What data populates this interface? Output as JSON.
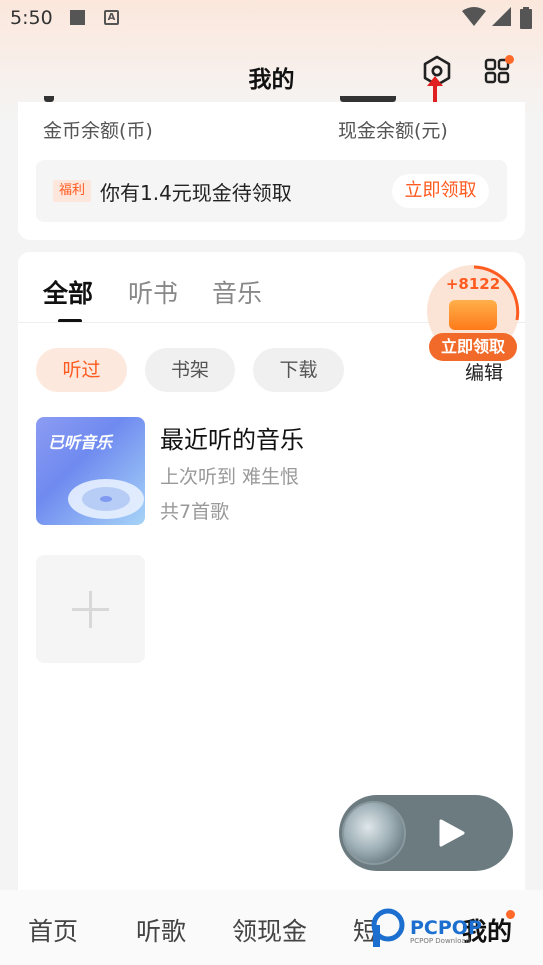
{
  "status_bar": {
    "time": "5:50"
  },
  "header": {
    "title": "我的"
  },
  "balance": {
    "coin_label": "金币余额(币)",
    "cash_label": "现金余额(元)",
    "welfare_tag": "福利",
    "welfare_text": "你有1.4元现金待领取",
    "claim_label": "立即领取"
  },
  "tabs": [
    {
      "label": "全部",
      "active": true
    },
    {
      "label": "听书",
      "active": false
    },
    {
      "label": "音乐",
      "active": false
    }
  ],
  "filters": [
    {
      "label": "听过",
      "active": true
    },
    {
      "label": "书架",
      "active": false
    },
    {
      "label": "下载",
      "active": false
    }
  ],
  "edit_label": "编辑",
  "recent_music": {
    "cover_text": "已听音乐",
    "title": "最近听的音乐",
    "last_played": "上次听到 难生恨",
    "count": "共7首歌"
  },
  "reward": {
    "amount": "+8122",
    "button": "立即领取"
  },
  "bottom_nav": [
    {
      "label": "首页",
      "active": false
    },
    {
      "label": "听歌",
      "active": false
    },
    {
      "label": "领现金",
      "active": false
    },
    {
      "label": "短",
      "active": false
    },
    {
      "label": "我的",
      "active": true
    }
  ],
  "watermark": {
    "text": "PCPOP",
    "sub": "PCPOP Download"
  },
  "colors": {
    "accent": "#ff5a1f",
    "accent_light": "#fde8de"
  }
}
